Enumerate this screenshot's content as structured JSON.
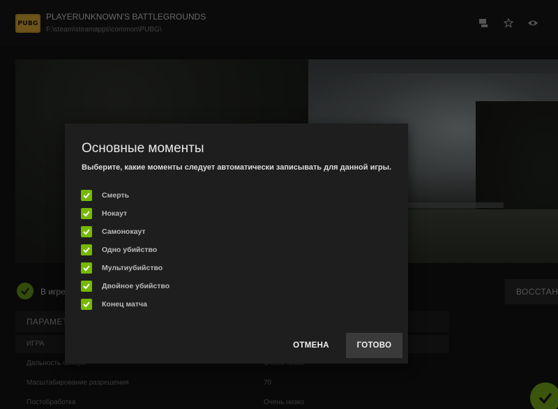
{
  "header": {
    "logo_text": "PUBG",
    "title": "PLAYERUNKNOWN'S BATTLEGROUNDS",
    "path": "F:\\steam\\steamapps\\common\\PUBG\\",
    "icons": [
      "monitor-icon",
      "star-icon",
      "eye-icon"
    ]
  },
  "status": {
    "text": "В игре",
    "restore_label": "ВОССТАН"
  },
  "settings": {
    "section_title": "ПАРАМЕТ",
    "column_header": "ИГРА",
    "rows": [
      {
        "label": "Дальность обзора",
        "value": "Очень низко"
      },
      {
        "label": "Масштабирование разрешения",
        "value": "70"
      },
      {
        "label": "Постобработка",
        "value": "Очень низко"
      }
    ]
  },
  "modal": {
    "title": "Основные моменты",
    "subtitle": "Выберите, какие моменты следует автоматически записывать для данной игры.",
    "options": [
      {
        "label": "Смерть",
        "checked": true
      },
      {
        "label": "Нокаут",
        "checked": true
      },
      {
        "label": "Самонокаут",
        "checked": true
      },
      {
        "label": "Одно убийство",
        "checked": true
      },
      {
        "label": "Мультиубийство",
        "checked": true
      },
      {
        "label": "Двойное убийство",
        "checked": true
      },
      {
        "label": "Конец матча",
        "checked": true
      }
    ],
    "cancel_label": "ОТМЕНА",
    "done_label": "ГОТОВО"
  },
  "colors": {
    "accent": "#76b900",
    "modal_bg": "#1e1e1e",
    "app_bg": "#121212"
  }
}
